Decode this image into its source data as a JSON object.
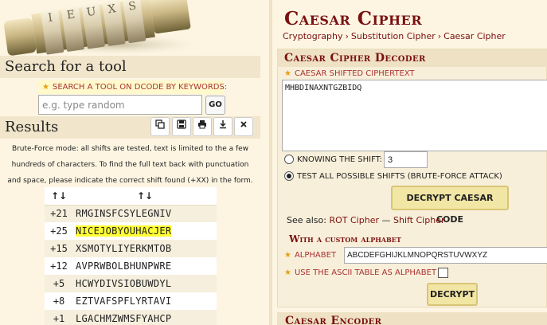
{
  "search": {
    "heading": "Search for a tool",
    "label": "SEARCH A TOOL ON DCODE BY KEYWORDS:",
    "placeholder": "e.g. type random",
    "go_label": "GO"
  },
  "results": {
    "heading": "Results",
    "note": "Brute-Force mode: all shifts are tested, text is limited to the a few hundreds of characters. To find the full text back with punctuation and space, please indicate the correct shift found (+XX) in the form.",
    "col_shift": "↑↓",
    "col_text": "↑↓",
    "rows": [
      {
        "shift": "+21",
        "text": "RMGINSFCSYLEGNIV"
      },
      {
        "shift": "+25",
        "text": "NICEJOBYOUHACJER"
      },
      {
        "shift": "+15",
        "text": "XSMOTYLIYERKMTOB"
      },
      {
        "shift": "+12",
        "text": "AVPRWBOLBHUNPWRE"
      },
      {
        "shift": "+5",
        "text": "HCWYDIVSIOBUWDYL"
      },
      {
        "shift": "+8",
        "text": "EZTVAFSPFLYRTAVI"
      },
      {
        "shift": "+1",
        "text": "LGACHMZWMSFYAHCP"
      }
    ]
  },
  "page": {
    "title": "Caesar Cipher",
    "breadcrumb": [
      "Cryptography",
      "Substitution Cipher",
      "Caesar Cipher"
    ]
  },
  "decoder": {
    "heading": "Caesar Cipher Decoder",
    "ciphertext_label": "CAESAR SHIFTED CIPHERTEXT",
    "ciphertext": "MHBDINAXNTGZBIDQ",
    "knowing_shift_label": "KNOWING THE SHIFT:",
    "shift_value": "3",
    "brute_force_label": "TEST ALL POSSIBLE SHIFTS (BRUTE-FORCE ATTACK)",
    "decrypt_label": "DECRYPT CAESAR CODE",
    "see_also_prefix": "See also:",
    "see_also_links": [
      "ROT Cipher",
      "Shift Cipher"
    ],
    "see_also_sep": "—",
    "custom_heading": "With a custom alphabet",
    "alphabet_label": "ALPHABET",
    "alphabet_value": "ABCDEFGHIJKLMNOPQRSTUVWXYZ",
    "ascii_label": "USE THE ASCII TABLE AS ALPHABET",
    "decrypt2_label": "DECRYPT"
  },
  "encoder": {
    "heading": "Caesar Encoder"
  }
}
